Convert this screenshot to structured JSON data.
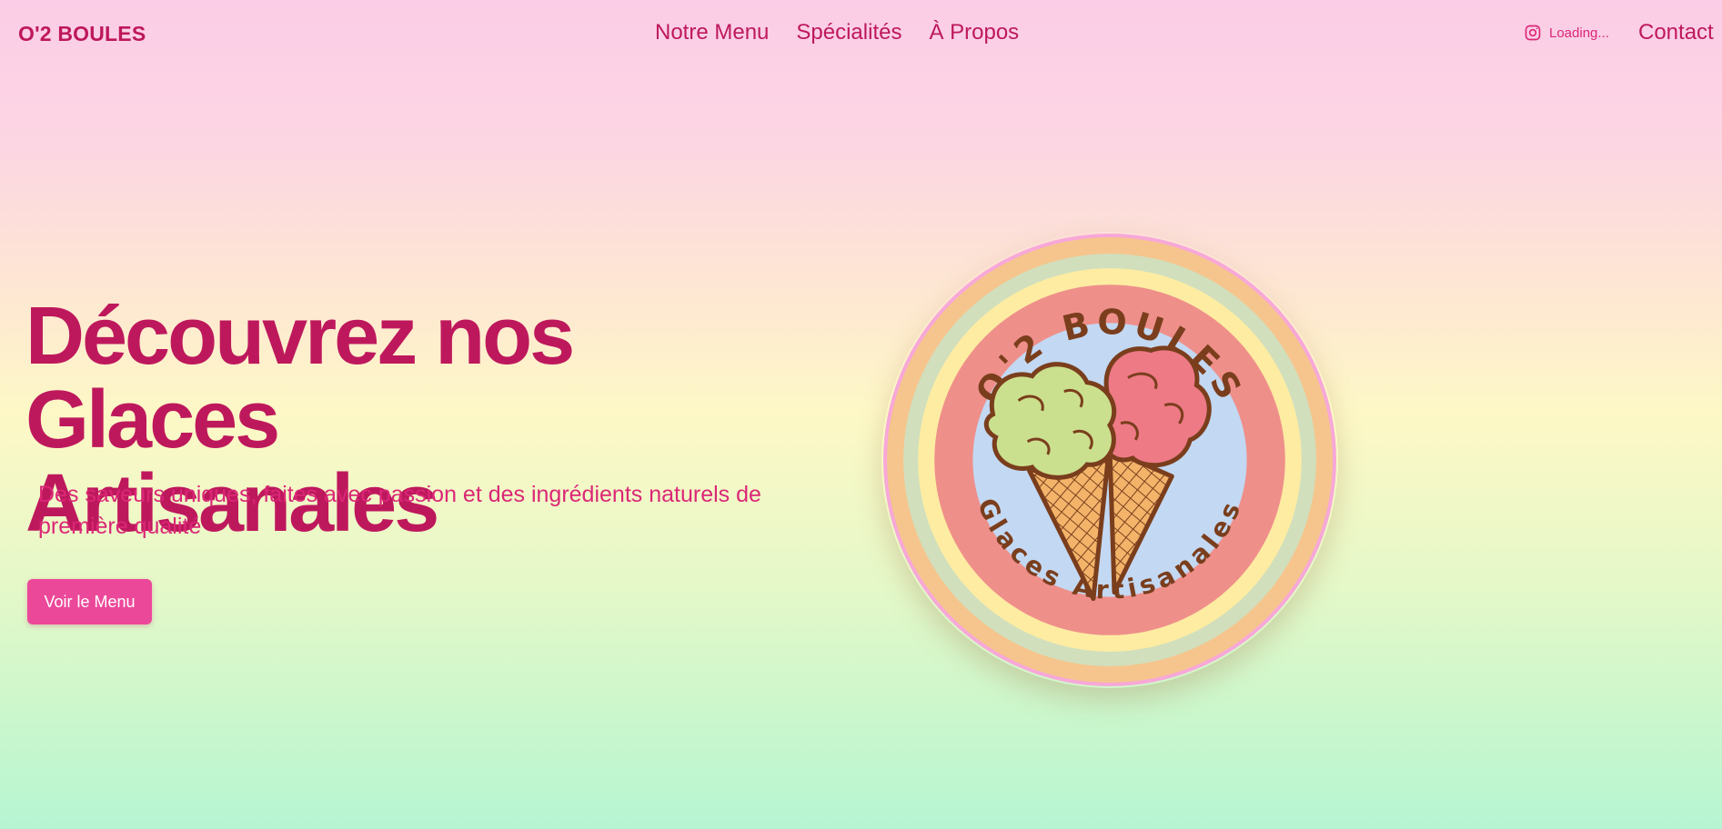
{
  "nav": {
    "brand": "O'2 BOULES",
    "links": [
      "Notre Menu",
      "Spécialités",
      "À Propos"
    ],
    "instagram_status": "Loading...",
    "instagram_icon": "instagram-icon",
    "contact": "Contact"
  },
  "hero": {
    "title_line1": "Découvrez nos Glaces",
    "title_line2": "Artisanales",
    "subtitle": "Des saveurs uniques, faites avec passion et des ingrédients naturels de première qualité",
    "cta_label": "Voir le Menu"
  },
  "logo": {
    "top_text": "O'2 BOULES",
    "bottom_text": "Glaces Artisanales"
  },
  "colors": {
    "primary_text": "#be185d",
    "accent": "#ec4899",
    "logo_brown": "#7a3e1d"
  }
}
